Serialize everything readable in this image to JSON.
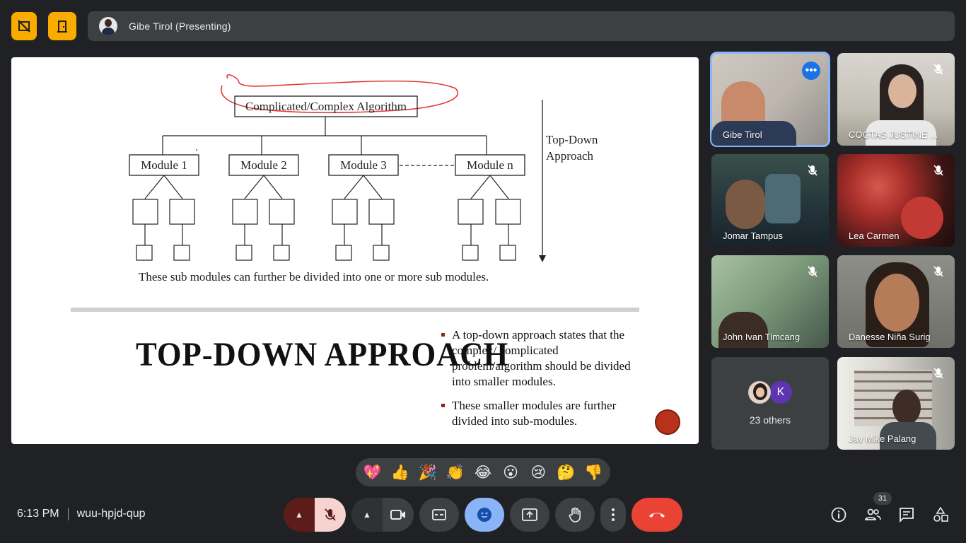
{
  "header": {
    "presenter_label": "Gibe Tirol (Presenting)",
    "left_buttons": [
      "fullscreen-off-icon",
      "exit-presentation-icon"
    ],
    "accent": "#f9ab00"
  },
  "slide": {
    "diagram": {
      "root": "Complicated/Complex Algorithm",
      "modules": [
        "Module 1",
        "Module 2",
        "Module 3",
        "Module n"
      ],
      "arrow_label_line1": "Top-Down",
      "arrow_label_line2": "Approach",
      "caption": "These sub modules can further be divided into one or more sub modules."
    },
    "title": "TOP-DOWN APPROACH",
    "bullets": [
      "A top-down approach states that the complex/ complicated problem/algorithm should be divided into smaller modules.",
      "These smaller modules are further divided into sub-modules."
    ]
  },
  "participants": [
    {
      "name": "Gibe Tirol",
      "muted": false,
      "active": true
    },
    {
      "name": "COGTAS JUSTINE ...",
      "muted": true,
      "active": false
    },
    {
      "name": "Jomar Tampus",
      "muted": true,
      "active": false
    },
    {
      "name": "Lea Carmen",
      "muted": true,
      "active": false
    },
    {
      "name": "John Ivan Timcang",
      "muted": true,
      "active": false
    },
    {
      "name": "Danesse Niña Surig",
      "muted": true,
      "active": false
    },
    {
      "name": "Jay Mike Palang",
      "muted": true,
      "active": false
    }
  ],
  "others": {
    "label": "23 others",
    "avatar_letter": "K"
  },
  "reactions": [
    "💖",
    "👍",
    "🎉",
    "👏",
    "😂",
    "😮",
    "😢",
    "🤔",
    "👎"
  ],
  "footer": {
    "time": "6:13 PM",
    "meeting_code": "wuu-hpjd-qup",
    "participant_count": "31",
    "colors": {
      "mic_off_bg": "#f6d2d0",
      "caret_bg": "#5c1d1a",
      "emoji_active": "#8ab4f8",
      "leave": "#ea4335"
    }
  }
}
